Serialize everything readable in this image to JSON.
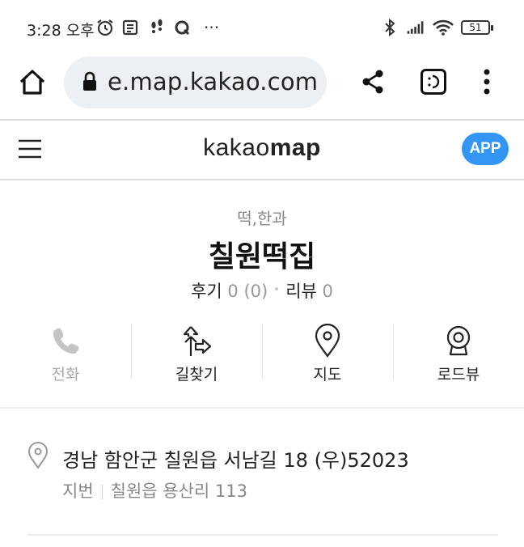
{
  "status_bar": {
    "time": "3:28 오후",
    "battery": "51",
    "more_notifications": "···"
  },
  "browser": {
    "url": "e.map.kakao.com"
  },
  "header": {
    "logo_light": "kakao",
    "logo_bold": "map",
    "app_badge": "APP"
  },
  "place": {
    "category": "떡,한과",
    "name": "칠원떡집",
    "review_label": "후기",
    "review_count": "0 (0)",
    "blog_label": "리뷰",
    "blog_count": "0"
  },
  "actions": [
    {
      "label": "전화",
      "icon": "phone-icon",
      "enabled": false
    },
    {
      "label": "길찾기",
      "icon": "directions-icon",
      "enabled": true
    },
    {
      "label": "지도",
      "icon": "map-pin-icon",
      "enabled": true
    },
    {
      "label": "로드뷰",
      "icon": "roadview-icon",
      "enabled": true
    }
  ],
  "address": {
    "road": "경남 함안군 칠원읍 서남길 18 (우)52023",
    "lot_label": "지번",
    "lot": "칠원읍 용산리 113"
  },
  "colors": {
    "app_badge": "#3396f4",
    "muted_text": "#888888",
    "url_bar_bg": "#eceff3"
  }
}
